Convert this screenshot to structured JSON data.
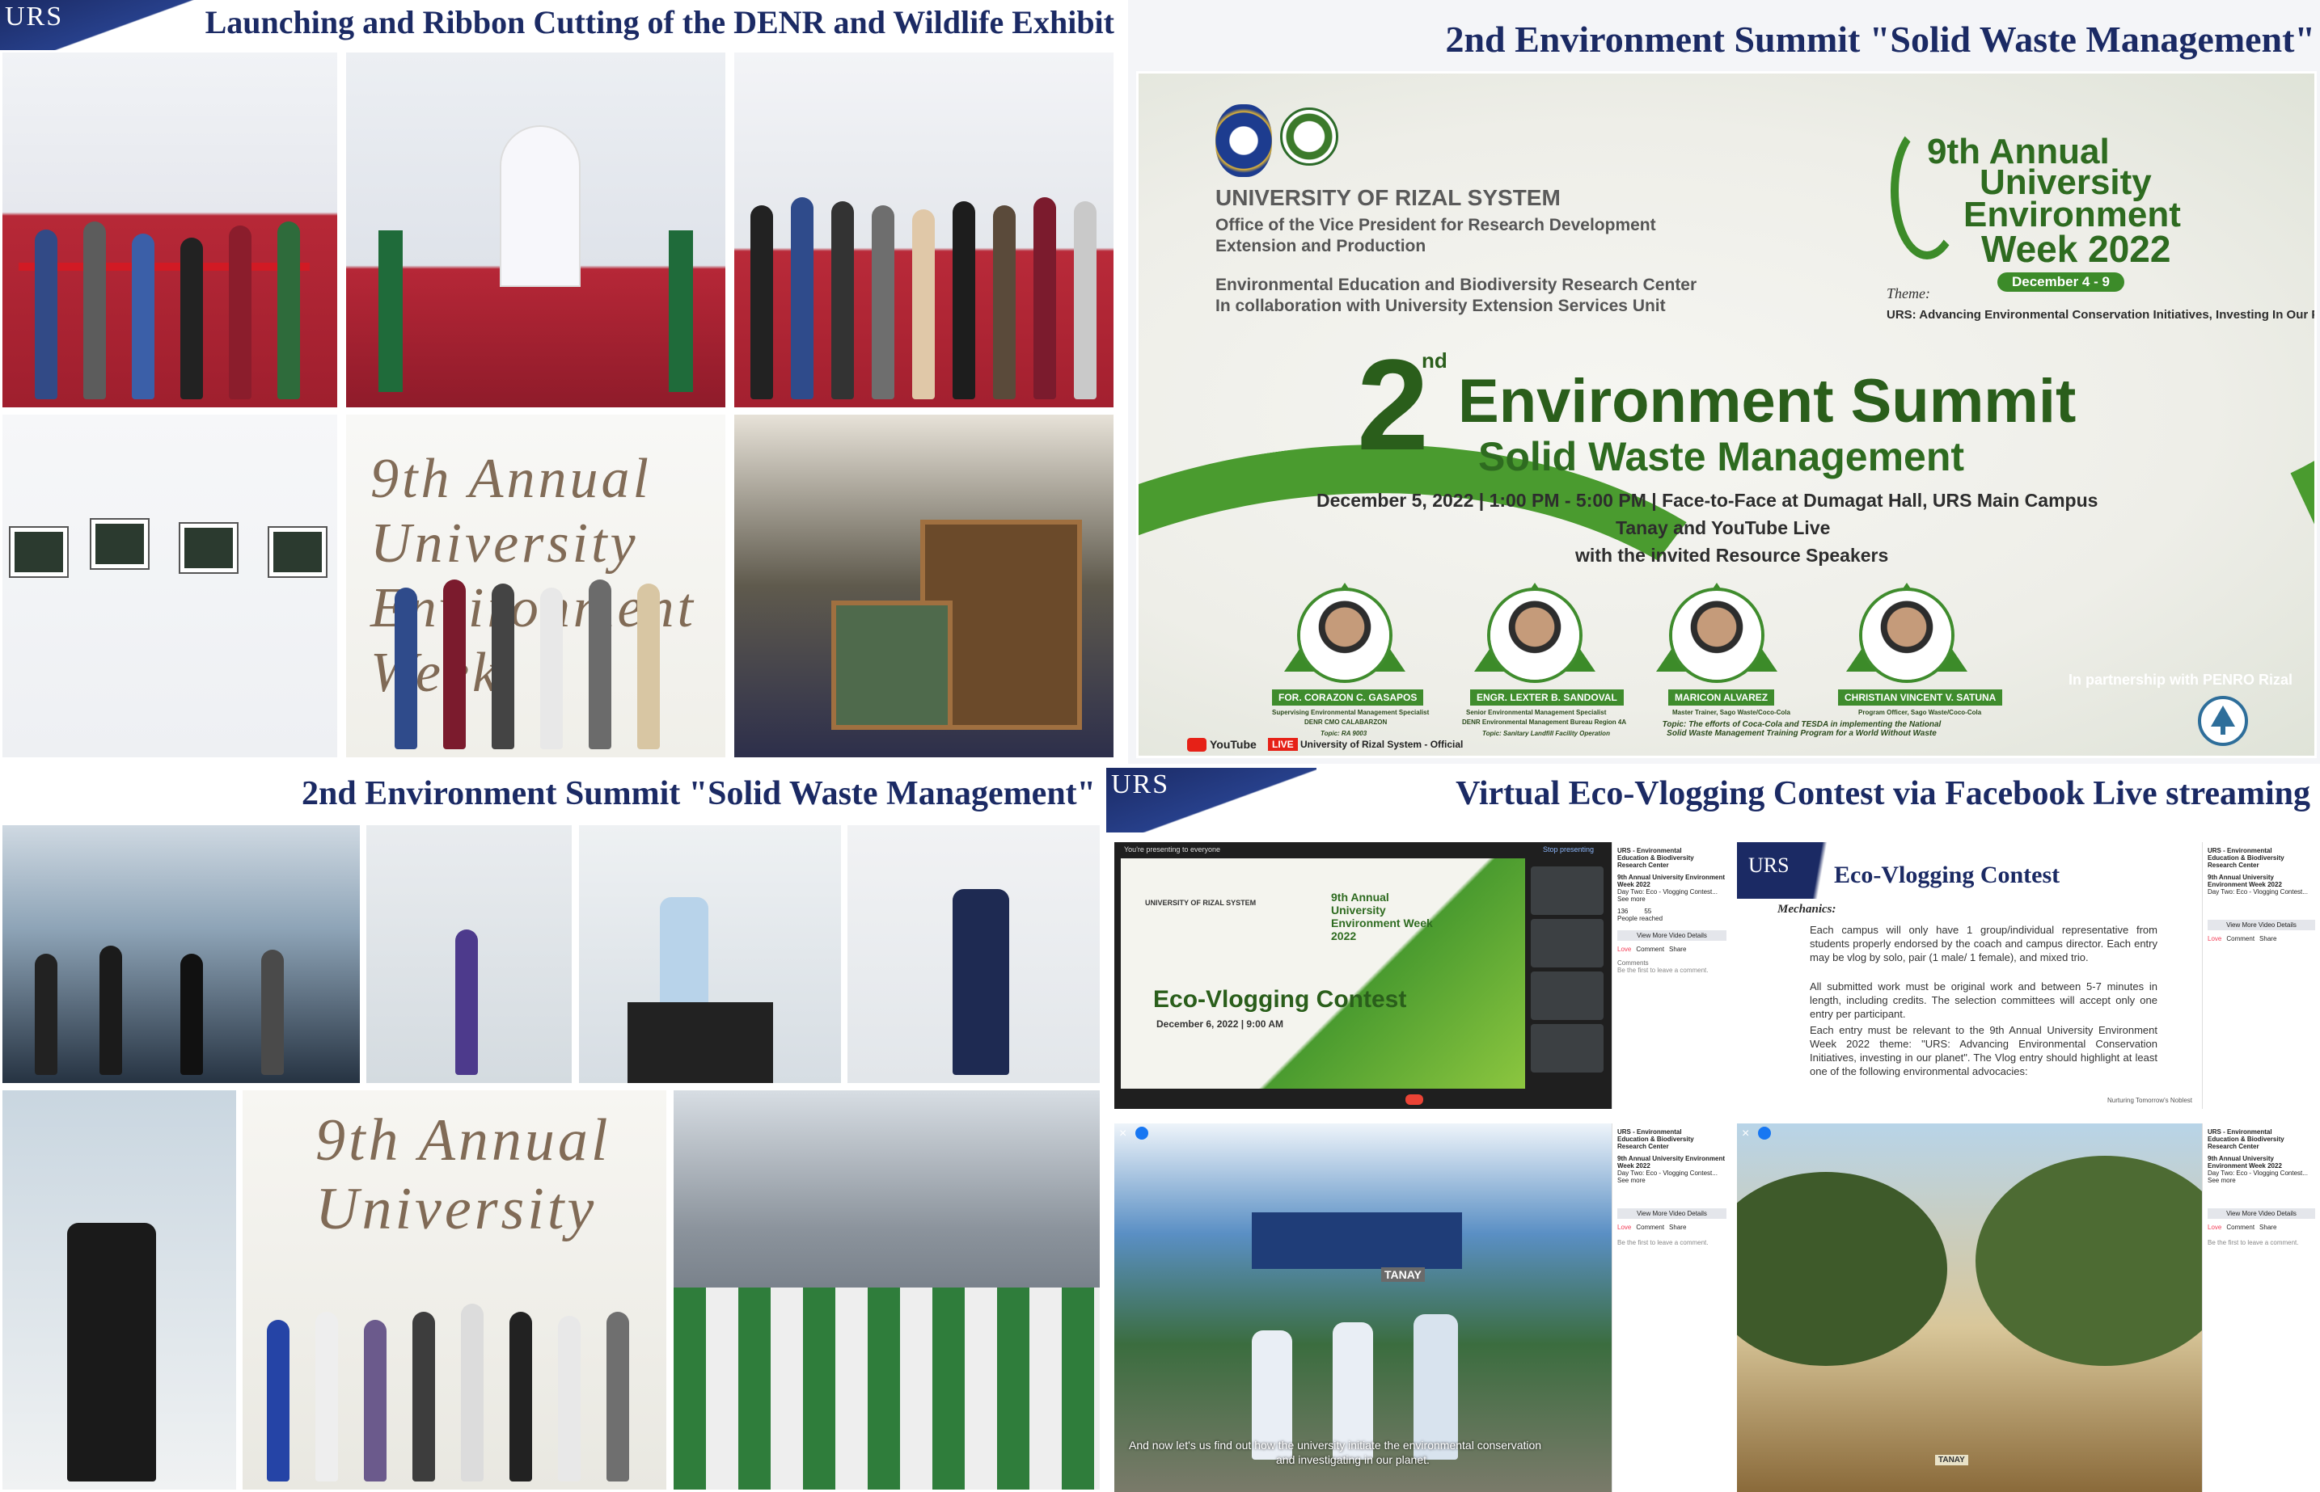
{
  "quadrants": {
    "top_left": {
      "brand": "URS",
      "title": "Launching and Ribbon Cutting of the DENR and Wildlife Exhibit",
      "photo_text": "9th Annual University Environment Week"
    },
    "top_right": {
      "title": "2nd Environment Summit \"Solid Waste Management\""
    },
    "bottom_left": {
      "title": "2nd Environment Summit \"Solid Waste Management\"",
      "photo_text": "9th Annual University"
    },
    "bottom_right": {
      "brand": "URS",
      "title": "Virtual Eco-Vlogging Contest via Facebook Live streaming"
    }
  },
  "poster": {
    "university": "UNIVERSITY OF RIZAL SYSTEM",
    "office_line1": "Office of the Vice President for Research Development",
    "office_line2": "Extension and Production",
    "center_line1": "Environmental Education and Biodiversity Research Center",
    "center_line2": "In collaboration with University Extension Services Unit",
    "week_line1": "9th Annual",
    "week_line2": "University",
    "week_line3": "Environment",
    "week_line4": "Week 2022",
    "week_dates": "December 4 - 9",
    "theme_label": "Theme:",
    "theme": "URS: Advancing Environmental Conservation Initiatives, Investing In Our Planet",
    "ordinal_num": "2",
    "ordinal_suffix": "nd",
    "summit_title": "Environment Summit",
    "summit_subtitle": "Solid Waste Management",
    "details_line1": "December 5, 2022 | 1:00 PM - 5:00 PM | Face-to-Face at Dumagat Hall, URS Main Campus",
    "details_line2": "Tanay and YouTube Live",
    "details_line3": "with the invited Resource Speakers",
    "partnership": "In partnership with PENRO Rizal",
    "youtube_label": "YouTube",
    "live_label": "LIVE",
    "channel": "University of Rizal System - Official",
    "speakers": [
      {
        "name": "FOR. CORAZON C. GASAPOS",
        "role": "Supervising Environmental Management Specialist",
        "org": "DENR CMO CALABARZON",
        "topic": "Topic: RA 9003"
      },
      {
        "name": "ENGR. LEXTER B. SANDOVAL",
        "role": "Senior Environmental Management Specialist",
        "org": "DENR Environmental Management Bureau Region 4A",
        "topic": "Topic: Sanitary Landfill Facility Operation"
      },
      {
        "name": "MARICON ALVAREZ",
        "role": "Master Trainer, Sago Waste/Coco-Cola",
        "org": "",
        "topic": ""
      },
      {
        "name": "CHRISTIAN VINCENT V. SATUNA",
        "role": "Program Officer, Sago Waste/Coco-Cola",
        "org": "",
        "topic": ""
      }
    ],
    "shared_topic": "Topic: The efforts of Coca-Cola and TESDA in implementing the National Solid Waste Management Training Program for a World Without Waste"
  },
  "vlog_screen": {
    "presenting": "You're presenting to everyone",
    "univ": "UNIVERSITY OF RIZAL SYSTEM",
    "week": "9th Annual University Environment Week 2022",
    "contest": "Eco-Vlogging Contest",
    "date": "December 6, 2022 | 9:00 AM",
    "stop_presenting": "Stop presenting"
  },
  "fb_panel": {
    "page": "URS - Environmental Education & Biodiversity Research Center",
    "post_title": "9th Annual University Environment Week 2022",
    "post_sub": "Day Two: Eco - Vlogging Contest...",
    "see_more": "See more",
    "stat1": "136",
    "stat1_label": "People reached",
    "stat2": "55",
    "stat2_label": "Reactions, comments and shares",
    "view_more": "View More Video Details",
    "like": "Love",
    "comment": "Comment",
    "share": "Share",
    "comments_label": "Comments",
    "first_comment": "Be the first to leave a comment."
  },
  "eco_slide": {
    "brand": "URS",
    "title": "Eco-Vlogging Contest",
    "mechanics": "Mechanics:",
    "items": [
      "Each campus will only have 1 group/individual representative from students properly endorsed by the coach and campus director. Each entry may be vlog by solo, pair (1 male/ 1 female), and mixed trio.",
      "All submitted work must be original work and between 5-7 minutes in length, including credits. The selection committees will accept only one entry per participant.",
      "Each entry must be relevant to the 9th Annual University Environment Week 2022 theme: \"URS: Advancing Environmental Conservation Initiatives, investing in our planet\". The Vlog entry should highlight at least one of the following environmental advocacies:"
    ],
    "footer": "Nurturing Tomorrow's Noblest"
  },
  "video_caption": {
    "line1": "And now let's us find out how the university initiate the environmental conservation",
    "line2": "and investigating in our planet."
  },
  "tent_sign": "TANAY",
  "colors": {
    "navy": "#1b2a64",
    "green": "#3f8c2d",
    "lime": "#8cc63f",
    "red": "#d11a24"
  }
}
